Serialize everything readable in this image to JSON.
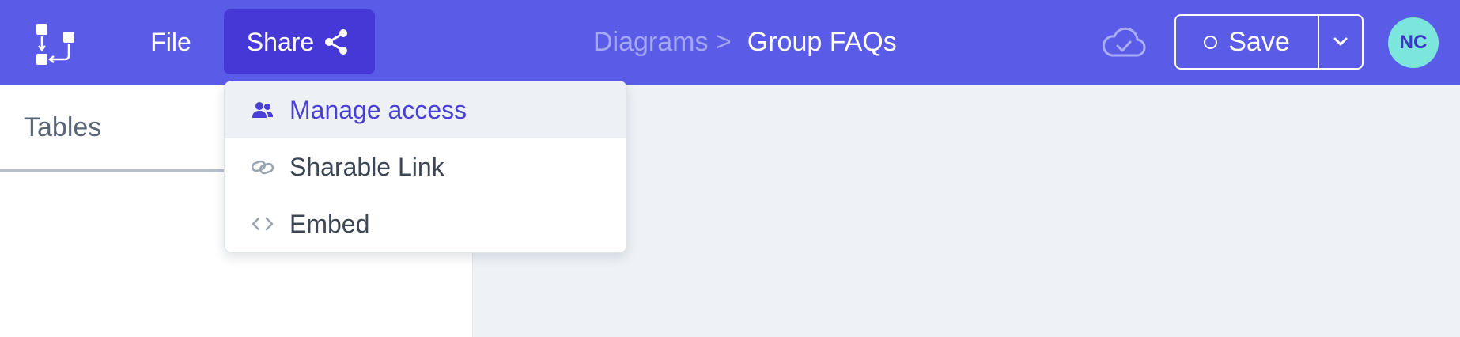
{
  "header": {
    "nav": {
      "file": "File",
      "share": "Share"
    },
    "breadcrumb": {
      "parent": "Diagrams >",
      "current": "Group FAQs"
    },
    "save_label": "Save",
    "avatar_initials": "NC"
  },
  "sidebar": {
    "title": "Tables"
  },
  "share_menu": {
    "items": [
      {
        "label": "Manage access",
        "icon": "users-icon"
      },
      {
        "label": "Sharable Link",
        "icon": "link-icon"
      },
      {
        "label": "Embed",
        "icon": "code-icon"
      }
    ]
  },
  "colors": {
    "topbar": "#5a5ce8",
    "share_active": "#4638d6",
    "avatar_bg": "#7de6dc",
    "menu_active_text": "#4a3fd4"
  }
}
